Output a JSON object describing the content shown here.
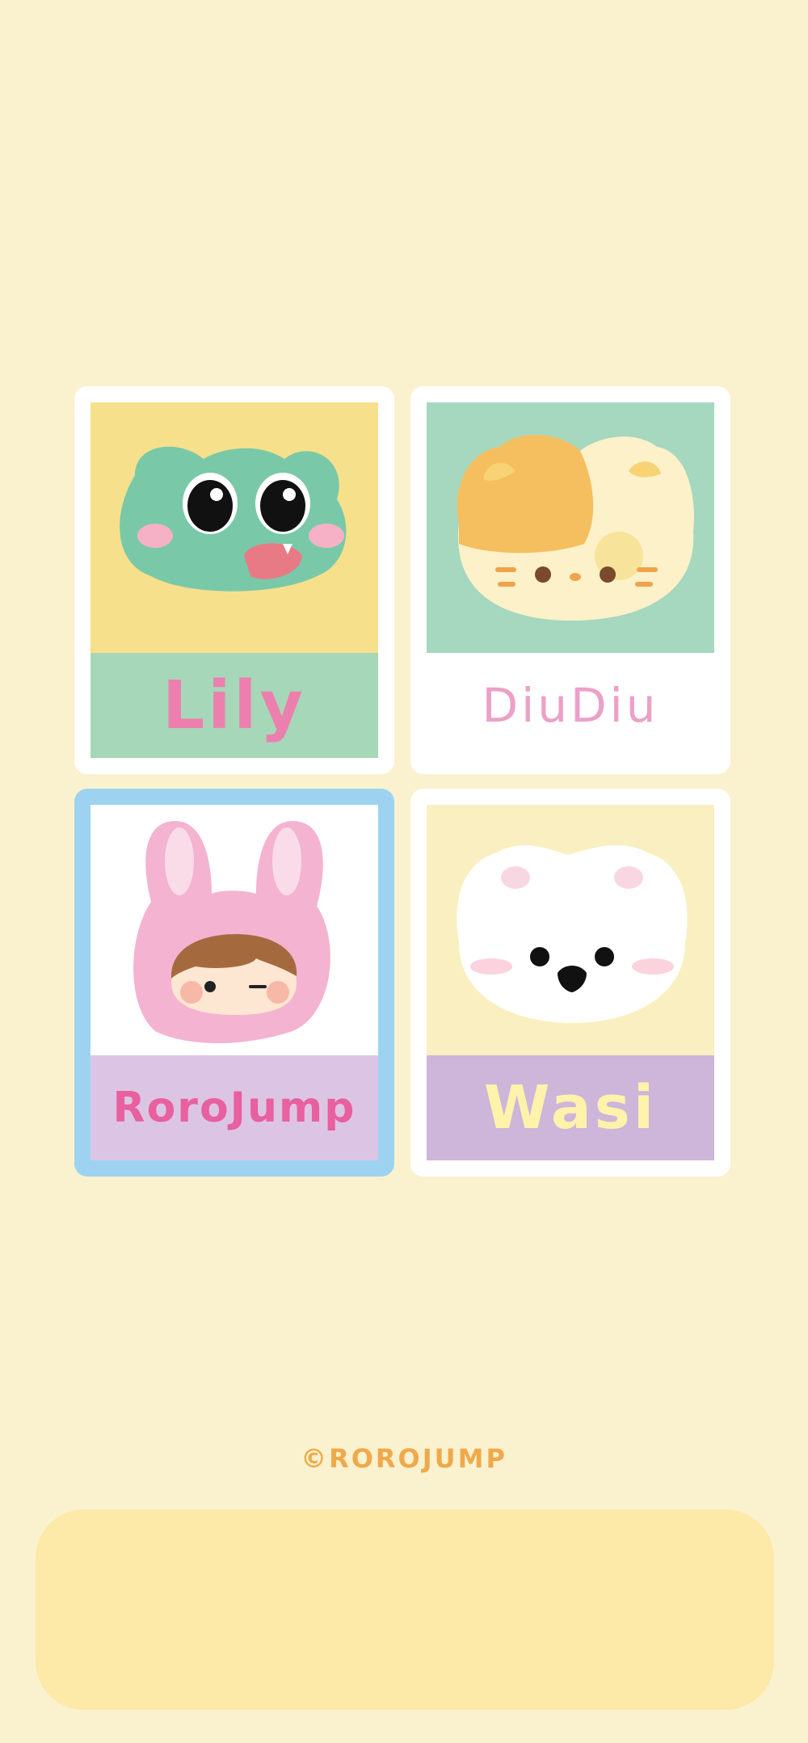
{
  "background": "#faf2cf",
  "stickers": [
    {
      "name": "Lily",
      "label_color": "#ec7fae",
      "art_bg": "#f7e08c",
      "label_bg": "#a6d7b8",
      "frame": "#ffffff",
      "selected": false,
      "icon": "frog-face-icon"
    },
    {
      "name": "DiuDiu",
      "label_color": "#eca0c8",
      "art_bg": "#a6d7bf",
      "label_bg": "#ffffff",
      "frame": "#ffffff",
      "selected": false,
      "icon": "cat-face-icon"
    },
    {
      "name": "RoroJump",
      "label_color": "#e8609f",
      "art_bg": "#ffffff",
      "label_bg": "#dcc5e4",
      "frame": "#9dd3f0",
      "selected": true,
      "icon": "bunny-hood-child-icon"
    },
    {
      "name": "Wasi",
      "label_color": "#fff2ab",
      "art_bg": "#faefc0",
      "label_bg": "#cdb6d9",
      "frame": "#ffffff",
      "selected": false,
      "icon": "white-bear-face-icon"
    }
  ],
  "copyright": "©ROROJUMP",
  "copyright_color": "#f0a94a",
  "dock_color": "#fde9a8"
}
